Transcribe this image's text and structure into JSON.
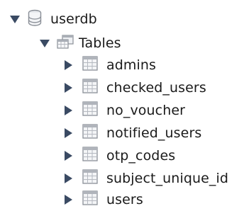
{
  "tree": {
    "database": {
      "label": "userdb",
      "icon": "database-icon",
      "expanded": true
    },
    "tables_group": {
      "label": "Tables",
      "icon": "tables-folder-icon",
      "expanded": true
    },
    "tables": [
      {
        "label": "admins",
        "icon": "table-icon",
        "expanded": false
      },
      {
        "label": "checked_users",
        "icon": "table-icon",
        "expanded": false
      },
      {
        "label": "no_voucher",
        "icon": "table-icon",
        "expanded": false
      },
      {
        "label": "notified_users",
        "icon": "table-icon",
        "expanded": false
      },
      {
        "label": "otp_codes",
        "icon": "table-icon",
        "expanded": false
      },
      {
        "label": "subject_unique_id",
        "icon": "table-icon",
        "expanded": false
      },
      {
        "label": "users",
        "icon": "table-icon",
        "expanded": false
      }
    ]
  },
  "colors": {
    "arrow": "#3a4a63",
    "text": "#1a1a1a",
    "icon_gray": "#8a8f97"
  }
}
